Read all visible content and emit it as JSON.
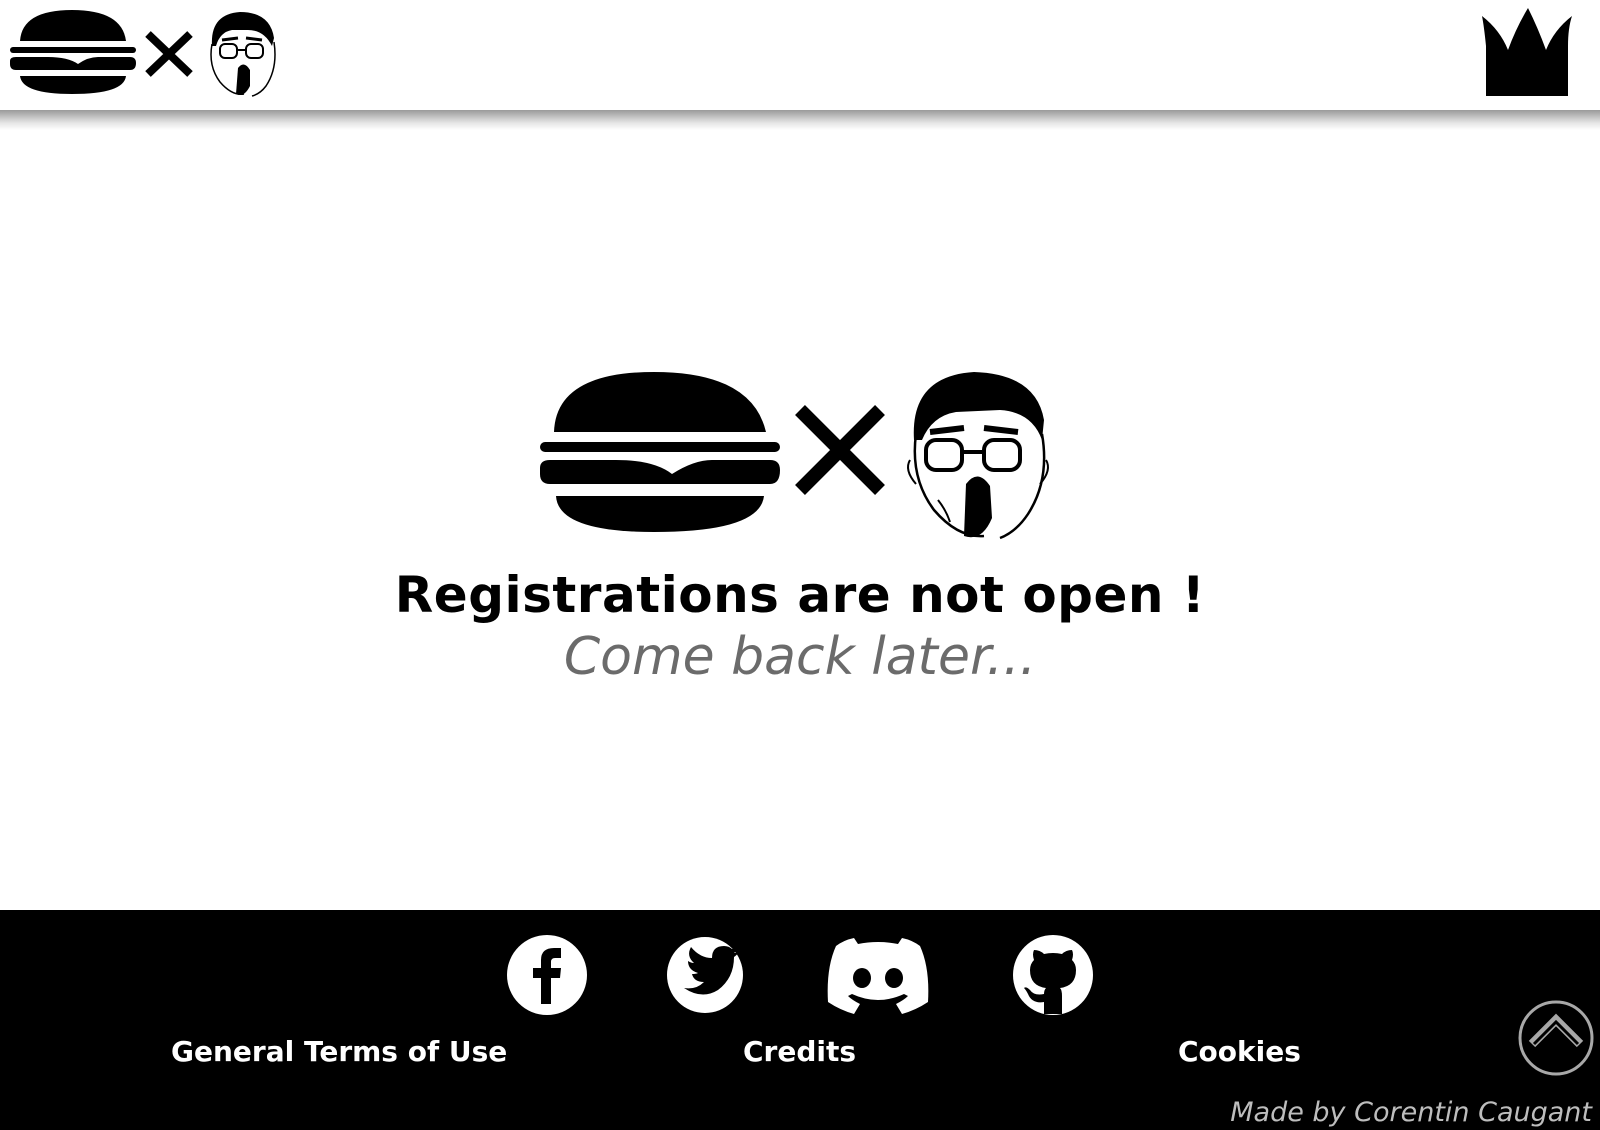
{
  "header": {
    "brand_icons": [
      "burger-icon",
      "cross-icon",
      "face-icon"
    ],
    "crown_icon": "crown-icon"
  },
  "main": {
    "hero_icons": [
      "burger-icon",
      "cross-icon",
      "face-icon"
    ],
    "title": "Registrations are not open !",
    "subtitle": "Come back later..."
  },
  "footer": {
    "social": [
      {
        "name": "facebook",
        "icon": "facebook-icon"
      },
      {
        "name": "twitter",
        "icon": "twitter-icon"
      },
      {
        "name": "discord",
        "icon": "discord-icon"
      },
      {
        "name": "github",
        "icon": "github-icon"
      }
    ],
    "links": {
      "terms": "General Terms of Use",
      "credits": "Credits",
      "cookies": "Cookies"
    },
    "made_by": "Made by Corentin Caugant",
    "scroll_top_icon": "chevron-up-icon"
  },
  "colors": {
    "background": "#ffffff",
    "footer_background": "#000000",
    "title": "#000000",
    "subtitle": "#6b6b6b",
    "footer_text": "#ffffff",
    "credit_text": "#bdbdbd"
  }
}
